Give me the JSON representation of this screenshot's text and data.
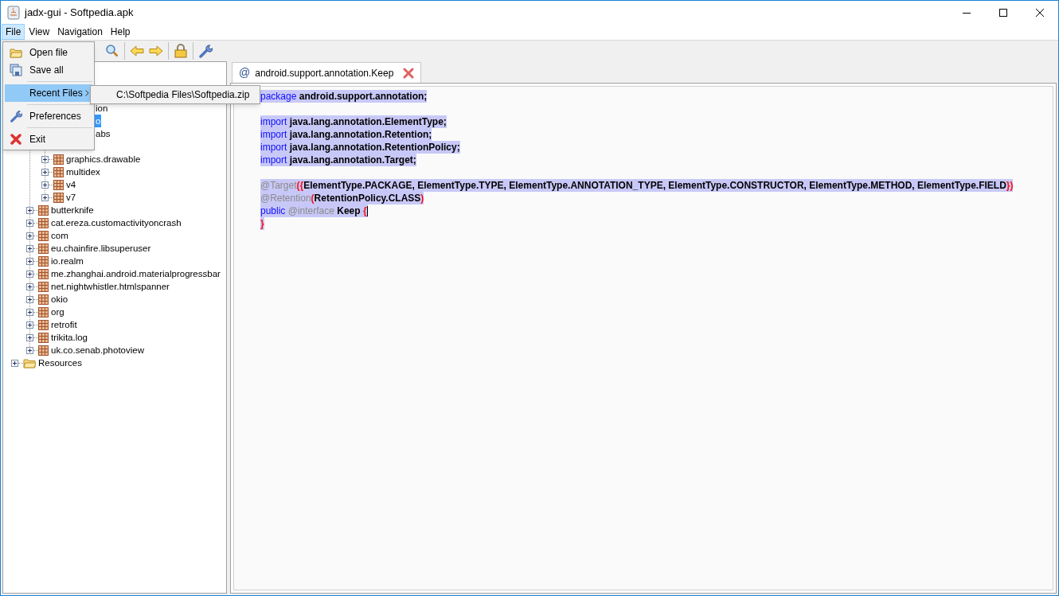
{
  "window": {
    "title": "jadx-gui - Softpedia.apk"
  },
  "menu_bar": [
    {
      "label": "File",
      "selected": true
    },
    {
      "label": "View",
      "selected": false
    },
    {
      "label": "Navigation",
      "selected": false
    },
    {
      "label": "Help",
      "selected": false
    }
  ],
  "file_menu": {
    "items": [
      {
        "kind": "open",
        "label": "Open file",
        "selected": false
      },
      {
        "kind": "save",
        "label": "Save all",
        "selected": false
      },
      {
        "kind": "separator"
      },
      {
        "kind": "recent",
        "label": "Recent Files",
        "selected": true,
        "submenu": true
      },
      {
        "kind": "separator"
      },
      {
        "kind": "preferences",
        "label": "Preferences",
        "selected": false
      },
      {
        "kind": "separator"
      },
      {
        "kind": "exit",
        "label": "Exit",
        "selected": false
      }
    ],
    "submenu": [
      "C:\\Softpedia Files\\Softpedia.zip"
    ]
  },
  "toolbar": [
    {
      "kind": "search"
    },
    {
      "kind": "separator"
    },
    {
      "kind": "back"
    },
    {
      "kind": "forward"
    },
    {
      "kind": "separator"
    },
    {
      "kind": "decompile"
    },
    {
      "kind": "separator"
    },
    {
      "kind": "settings"
    }
  ],
  "tree": {
    "partial_rows": [
      {
        "label": "ion",
        "selected": false
      },
      {
        "label": "o",
        "selected": true
      },
      {
        "label": "abs",
        "selected": false
      }
    ],
    "items": [
      {
        "children": [
          {
            "children": [
              {
                "label": "graphics.drawable",
                "selected": false
              },
              {
                "label": "multidex",
                "selected": false
              },
              {
                "label": "v4",
                "selected": false
              },
              {
                "label": "v7",
                "selected": false
              }
            ]
          },
          {
            "label": "butterknife",
            "selected": false
          },
          {
            "label": "cat.ereza.customactivityoncrash",
            "selected": false
          },
          {
            "label": "com",
            "selected": false
          },
          {
            "label": "eu.chainfire.libsuperuser",
            "selected": false
          },
          {
            "label": "io.realm",
            "selected": false
          },
          {
            "label": "me.zhanghai.android.materialprogressbar",
            "selected": false
          },
          {
            "label": "net.nightwhistler.htmlspanner",
            "selected": false
          },
          {
            "label": "okio",
            "selected": false
          },
          {
            "label": "org",
            "selected": false
          },
          {
            "label": "retrofit",
            "selected": false
          },
          {
            "label": "trikita.log",
            "selected": false
          },
          {
            "label": "uk.co.senab.photoview",
            "selected": false
          }
        ]
      },
      {
        "label": "Resources",
        "kind": "resources",
        "selected": false
      }
    ]
  },
  "tabs": [
    {
      "symbol": "@",
      "label": "android.support.annotation.Keep",
      "selected": true
    }
  ],
  "code": [
    {
      "kind": "code",
      "segments": [
        {
          "kind": "keyword",
          "text": "package"
        },
        {
          "kind": "plain",
          "text": " android.support.annotation;"
        }
      ]
    },
    {
      "kind": "blank"
    },
    {
      "kind": "code",
      "segments": [
        {
          "kind": "keyword",
          "text": "import"
        },
        {
          "kind": "plain",
          "text": " java.lang.annotation.ElementType;"
        }
      ]
    },
    {
      "kind": "code",
      "segments": [
        {
          "kind": "keyword",
          "text": "import"
        },
        {
          "kind": "plain",
          "text": " java.lang.annotation.Retention;"
        }
      ]
    },
    {
      "kind": "code",
      "segments": [
        {
          "kind": "keyword",
          "text": "import"
        },
        {
          "kind": "plain",
          "text": " java.lang.annotation.RetentionPolicy;"
        }
      ]
    },
    {
      "kind": "code",
      "segments": [
        {
          "kind": "keyword",
          "text": "import"
        },
        {
          "kind": "plain",
          "text": " java.lang.annotation.Target;"
        }
      ]
    },
    {
      "kind": "blank"
    },
    {
      "kind": "code",
      "segments": [
        {
          "kind": "annotation",
          "text": "@Target"
        },
        {
          "kind": "brace",
          "text": "({"
        },
        {
          "kind": "plain",
          "text": "ElementType.PACKAGE, ElementType.TYPE, ElementType.ANNOTATION_TYPE, ElementType.CONSTRUCTOR, ElementType.METHOD, ElementType.FIELD"
        },
        {
          "kind": "brace",
          "text": "})"
        }
      ]
    },
    {
      "kind": "code",
      "segments": [
        {
          "kind": "annotation",
          "text": "@Retention"
        },
        {
          "kind": "brace",
          "text": "("
        },
        {
          "kind": "plain",
          "text": "RetentionPolicy.CLASS"
        },
        {
          "kind": "brace",
          "text": ")"
        }
      ]
    },
    {
      "kind": "code",
      "caret": true,
      "segments": [
        {
          "kind": "keyword",
          "text": "public"
        },
        {
          "kind": "annotation",
          "text": " @interface"
        },
        {
          "kind": "plain",
          "text": " Keep "
        },
        {
          "kind": "brace",
          "text": "{"
        }
      ]
    },
    {
      "kind": "code",
      "segments": [
        {
          "kind": "brace",
          "text": "}"
        }
      ]
    }
  ]
}
